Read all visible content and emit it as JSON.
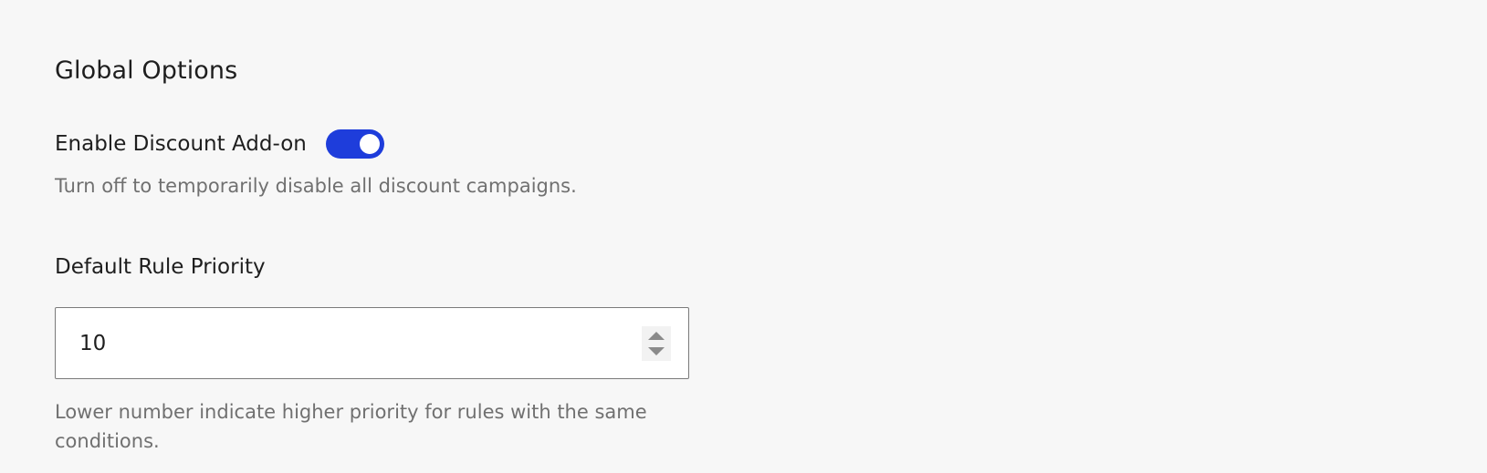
{
  "global_options": {
    "title": "Global Options",
    "enable_discount": {
      "label": "Enable Discount Add-on",
      "enabled": true,
      "help": "Turn off to temporarily disable all discount campaigns.",
      "accent_color": "#1e3ddb"
    },
    "default_rule_priority": {
      "label": "Default Rule Priority",
      "value": "10",
      "help": "Lower number indicate higher priority for rules with the same conditions."
    }
  },
  "icons": {
    "spinner_up": "triangle-up",
    "spinner_down": "triangle-down"
  }
}
